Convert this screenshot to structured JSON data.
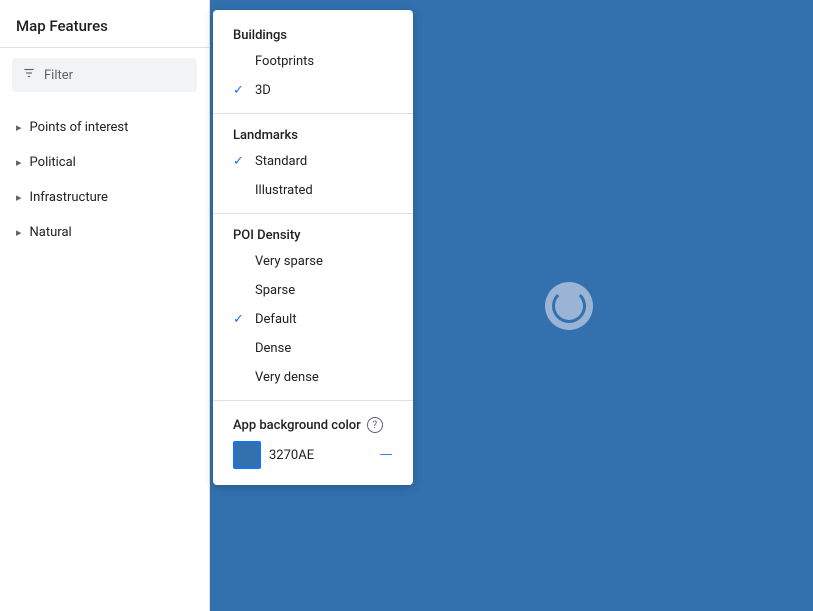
{
  "sidebar": {
    "title": "Map Features",
    "filter": {
      "placeholder": "Filter"
    },
    "nav_items": [
      {
        "id": "poi",
        "label": "Points of interest"
      },
      {
        "id": "political",
        "label": "Political"
      },
      {
        "id": "infrastructure",
        "label": "Infrastructure"
      },
      {
        "id": "natural",
        "label": "Natural"
      }
    ]
  },
  "dropdown": {
    "sections": [
      {
        "id": "buildings",
        "title": "Buildings",
        "items": [
          {
            "id": "footprints",
            "label": "Footprints",
            "checked": false
          },
          {
            "id": "3d",
            "label": "3D",
            "checked": true
          }
        ]
      },
      {
        "id": "landmarks",
        "title": "Landmarks",
        "items": [
          {
            "id": "standard",
            "label": "Standard",
            "checked": true
          },
          {
            "id": "illustrated",
            "label": "Illustrated",
            "checked": false
          }
        ]
      },
      {
        "id": "poi_density",
        "title": "POI Density",
        "items": [
          {
            "id": "very_sparse",
            "label": "Very sparse",
            "checked": false
          },
          {
            "id": "sparse",
            "label": "Sparse",
            "checked": false
          },
          {
            "id": "default",
            "label": "Default",
            "checked": true
          },
          {
            "id": "dense",
            "label": "Dense",
            "checked": false
          },
          {
            "id": "very_dense",
            "label": "Very dense",
            "checked": false
          }
        ]
      }
    ],
    "app_background": {
      "label": "App background color",
      "color_value": "3270AE",
      "color_hex": "#3270AE"
    }
  }
}
